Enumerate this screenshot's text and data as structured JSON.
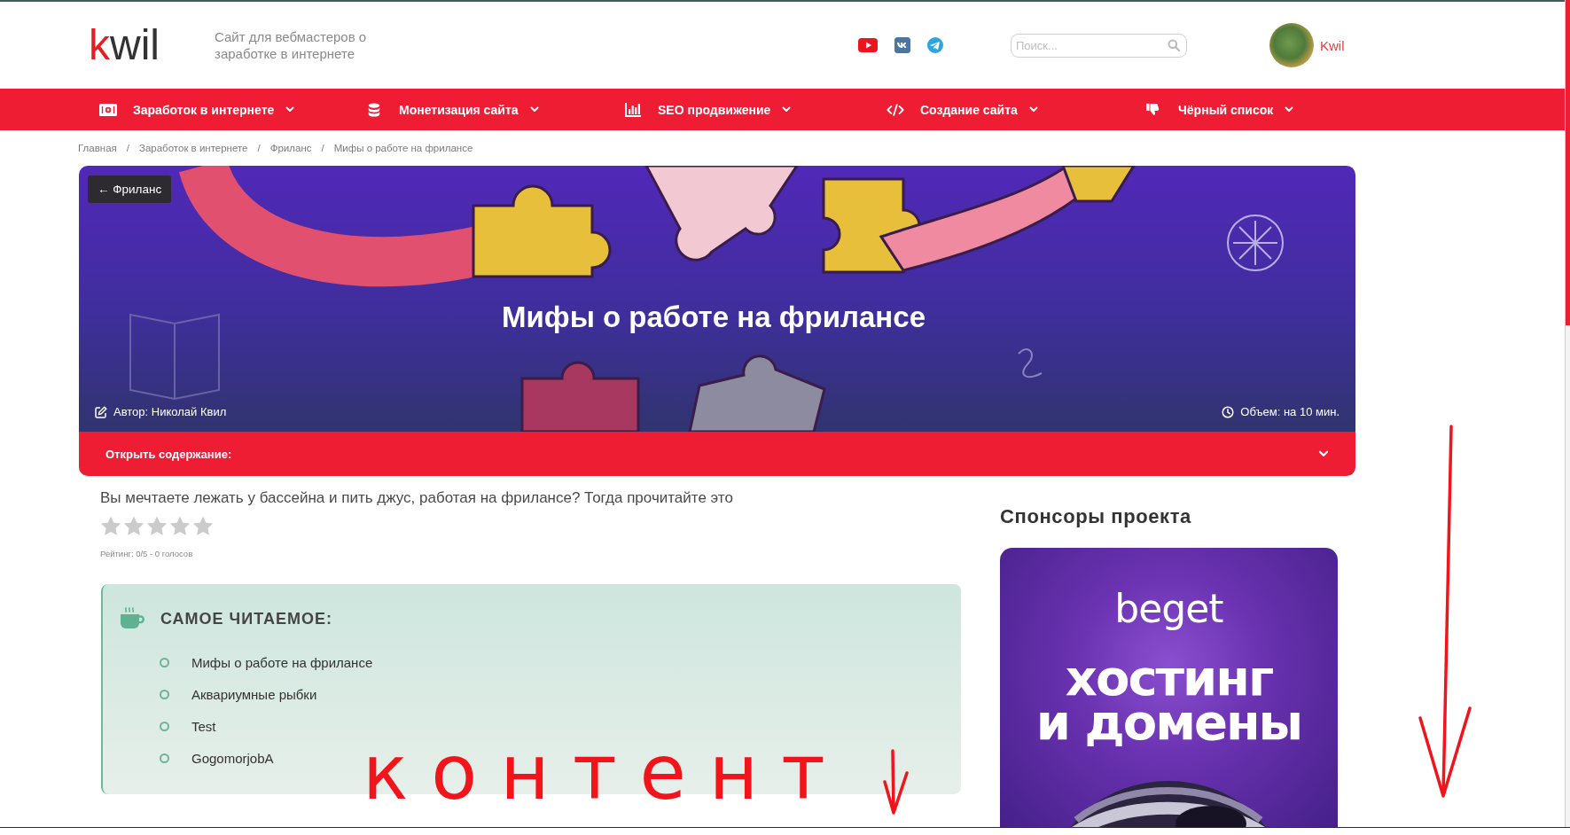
{
  "header": {
    "logo": "kwil",
    "tagline": "Сайт для вебмастеров о заработке в интернете",
    "search": {
      "placeholder": "Поиск..."
    },
    "user": {
      "name": "Kwil"
    }
  },
  "nav": [
    {
      "label": "Заработок в интернете"
    },
    {
      "label": "Монетизация сайта"
    },
    {
      "label": "SEO продвижение"
    },
    {
      "label": "Создание сайта"
    },
    {
      "label": "Чёрный список"
    }
  ],
  "breadcrumbs": {
    "separator": "/",
    "items": [
      "Главная",
      "Заработок в интернете",
      "Фриланс",
      "Мифы о работе на фрилансе"
    ]
  },
  "hero": {
    "back_link": "← Фриланс",
    "title": "Мифы о работе на фрилансе",
    "author": "Автор: Николай Квил",
    "reading_time": "Объем: на 10 мин.",
    "toc": {
      "label": "Открыть содержание:",
      "expanded": false
    }
  },
  "article": {
    "lead": "Вы мечтаете лежать у бассейна и пить джус, работая на фрилансе? Тогда прочитайте это",
    "rating": {
      "stars": 0,
      "text": "Рейтинг: 0/5 - 0 голосов"
    },
    "most_read": {
      "title": "САМОЕ ЧИТАЕМОЕ:",
      "items": [
        "Мифы о работе на фрилансе",
        "Аквариумные рыбки",
        "Test",
        "GogomorjobA"
      ]
    }
  },
  "sidebar": {
    "title": "Спонсоры проекта",
    "ad": {
      "logo": "beget",
      "headline_lines": [
        "хостинг",
        "и домены"
      ]
    }
  },
  "annotation": {
    "text": "контент"
  }
}
